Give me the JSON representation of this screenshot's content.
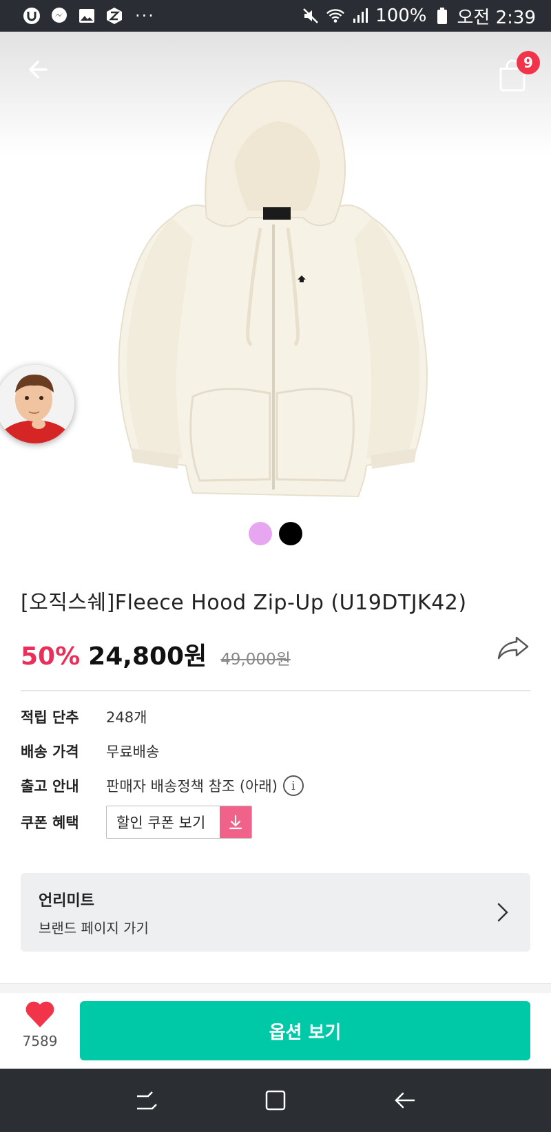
{
  "status_bar": {
    "battery_text": "100%",
    "time": "오전 2:39",
    "icons_left": [
      "u-app-icon",
      "messenger-icon",
      "gallery-icon",
      "z-app-icon",
      "more-dots-icon"
    ],
    "icons_right": [
      "mute-icon",
      "wifi-icon",
      "signal-icon",
      "battery-icon"
    ],
    "more": "···"
  },
  "header": {
    "cart_count": "9"
  },
  "product": {
    "colors": [
      "#e7a6f0",
      "#000000"
    ],
    "title": "[오직스쉐]Fleece Hood Zip-Up (U19DTJK42)",
    "discount": "50%",
    "price": "24,800원",
    "original_price": "49,000원"
  },
  "details": {
    "points_label": "적립 단추",
    "points_value": "248개",
    "shipping_label": "배송 가격",
    "shipping_value": "무료배송",
    "release_label": "출고 안내",
    "release_value": "판매자 배송정책 참조 (아래)",
    "coupon_label": "쿠폰 혜택",
    "coupon_button": "할인 쿠폰 보기"
  },
  "brand": {
    "name": "언리미트",
    "link": "브랜드 페이지 가기"
  },
  "bottom": {
    "like_count": "7589",
    "options_button": "옵션 보기"
  },
  "colors": {
    "accent": "#00c9a7",
    "discount": "#e8305a",
    "badge": "#f1344a",
    "heart": "#f1344a",
    "coupon": "#f0628a"
  }
}
